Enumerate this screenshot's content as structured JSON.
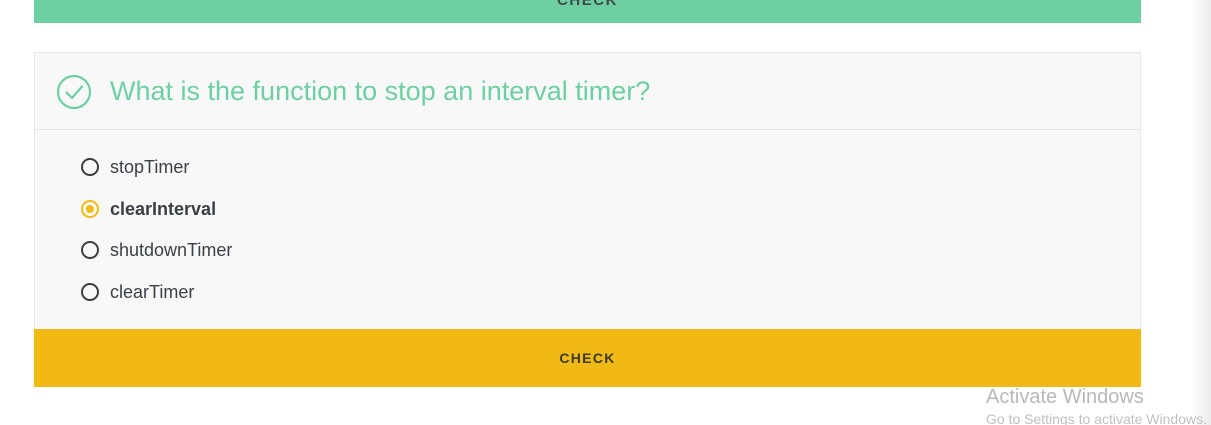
{
  "previous": {
    "check_label": "CHECK"
  },
  "quiz": {
    "question": "What is the function to stop an interval timer?",
    "status_icon": "check-circle-icon",
    "options": [
      {
        "label": "stopTimer",
        "selected": false
      },
      {
        "label": "clearInterval",
        "selected": true
      },
      {
        "label": "shutdownTimer",
        "selected": false
      },
      {
        "label": "clearTimer",
        "selected": false
      }
    ],
    "check_label": "CHECK"
  },
  "colors": {
    "accent_green": "#6ecfa3",
    "accent_yellow": "#f0b913",
    "card_bg": "#f8f8f8"
  },
  "watermark": {
    "title": "Activate Windows",
    "subtitle": "Go to Settings to activate Windows."
  }
}
